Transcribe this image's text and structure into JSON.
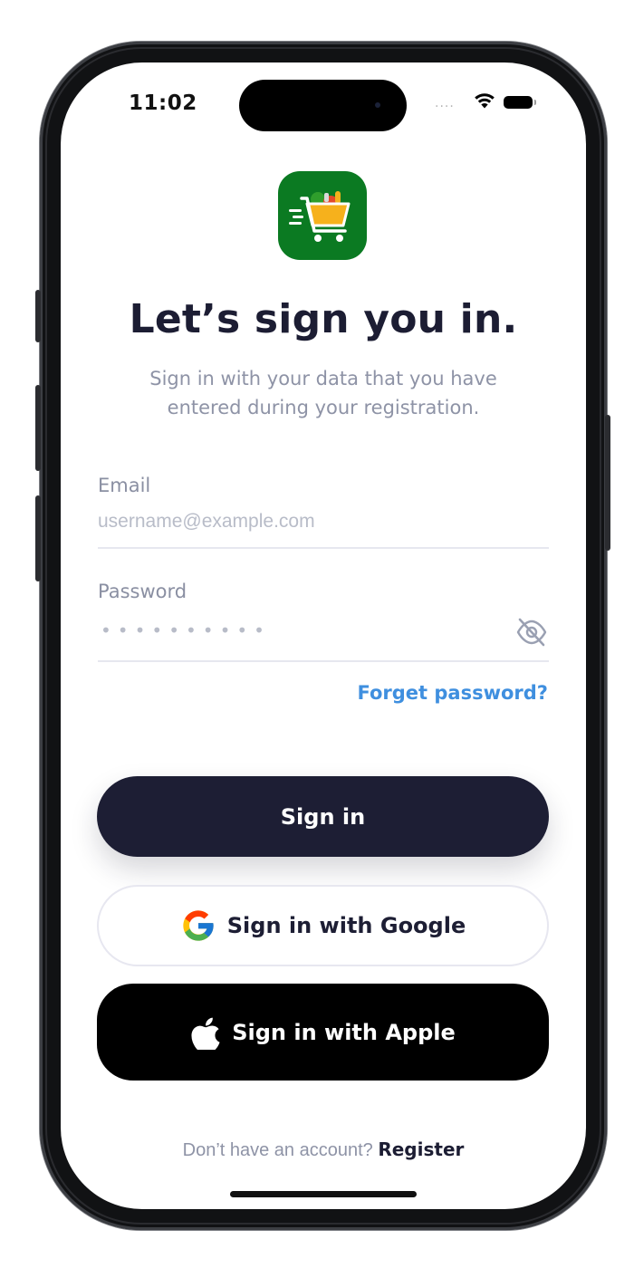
{
  "status_bar": {
    "time": "11:02",
    "signal": "....",
    "wifi_icon": "wifi-icon",
    "battery_icon": "battery-icon"
  },
  "app": {
    "logo_icon": "shopping-cart-groceries-icon",
    "brand_color": "#0b7a22"
  },
  "header": {
    "title": "Let’s sign you in.",
    "subtitle": "Sign in with your data that you have entered during your registration."
  },
  "form": {
    "email_label": "Email",
    "email_placeholder": "username@example.com",
    "email_value": "",
    "password_label": "Password",
    "password_mask": "••••••••••",
    "password_toggle_icon": "eye-off-icon",
    "forgot_label": "Forget password?"
  },
  "actions": {
    "signin_label": "Sign in",
    "google_label": "Sign in with Google",
    "apple_label": "Sign in with Apple"
  },
  "footer": {
    "prompt": "Don’t have an account?",
    "register_label": "Register"
  },
  "colors": {
    "primary": "#1d1e34",
    "link": "#3f8fdf",
    "muted": "#8e93a6"
  }
}
